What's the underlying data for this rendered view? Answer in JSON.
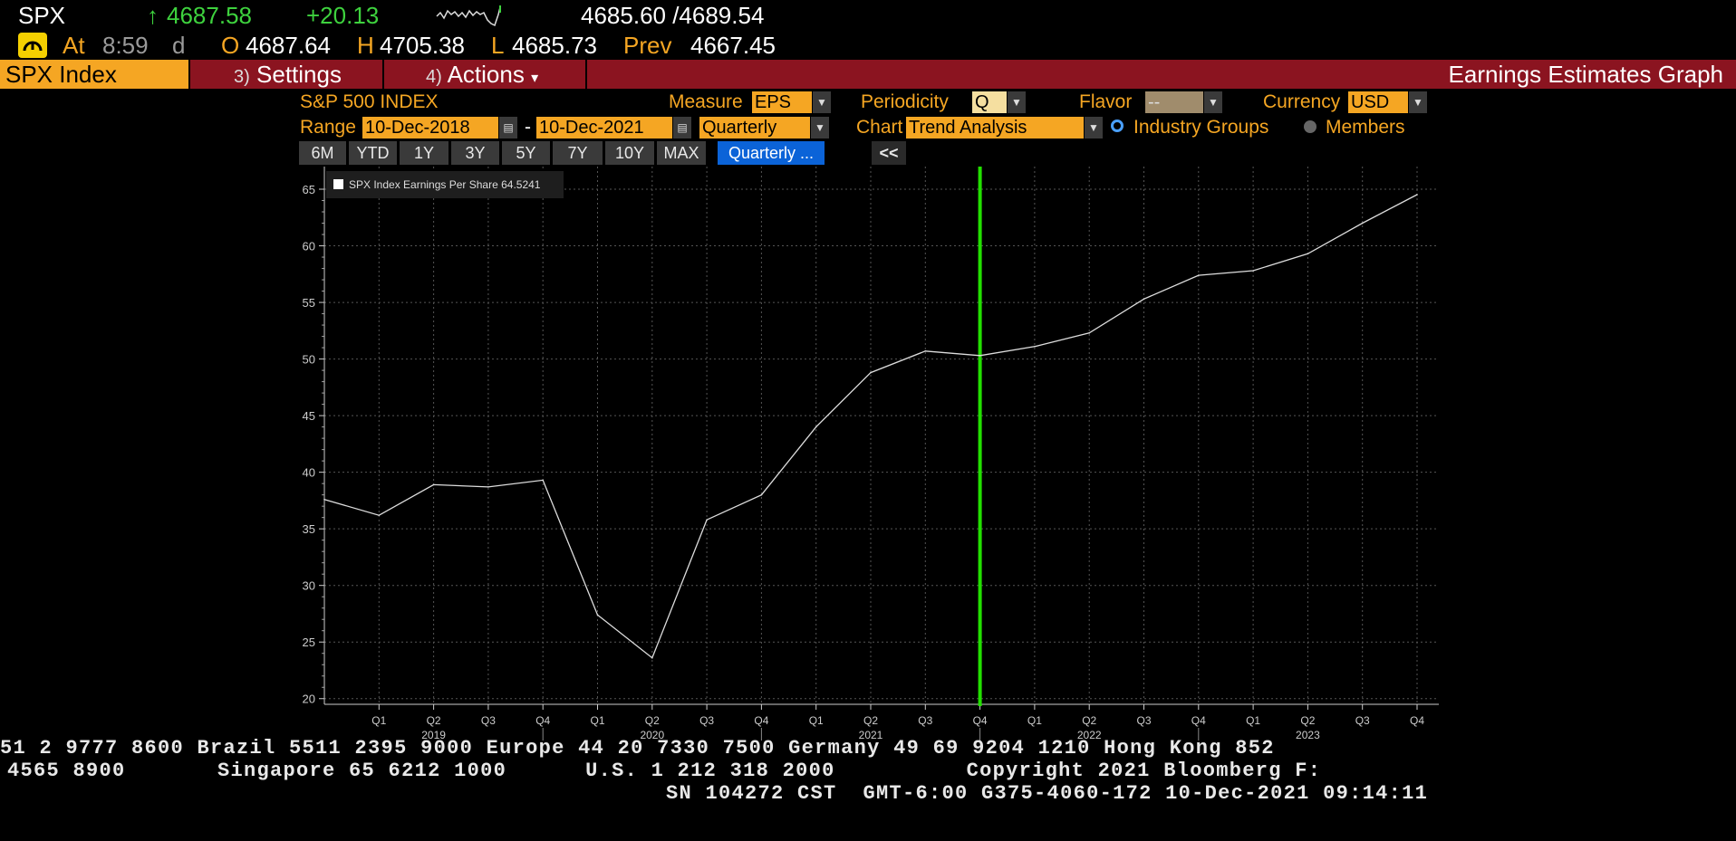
{
  "quote": {
    "ticker": "SPX",
    "arrow": "↑",
    "last": "4687.58",
    "change": "+20.13",
    "bid_ask": "4685.60 /4689.54",
    "at_label": "At",
    "time": "8:59",
    "d": "d",
    "o_label": "O",
    "open": "4687.64",
    "h_label": "H",
    "high": "4705.38",
    "l_label": "L",
    "low": "4685.73",
    "prev_label": "Prev",
    "prev": "4667.45"
  },
  "menu": {
    "security": "SPX Index",
    "settings_num": "3)",
    "settings": "Settings",
    "actions_num": "4)",
    "actions": "Actions",
    "caret": "▾",
    "screen_title": "Earnings Estimates Graph"
  },
  "controls": {
    "index_name": "S&P 500 INDEX",
    "measure_label": "Measure",
    "measure": "EPS",
    "periodicity_label": "Periodicity",
    "periodicity": "Q",
    "flavor_label": "Flavor",
    "flavor": "--",
    "currency_label": "Currency",
    "currency": "USD",
    "range_label": "Range",
    "start_date": "10-Dec-2018",
    "dash": "-",
    "end_date": "10-Dec-2021",
    "range_period": "Quarterly",
    "chart_label": "Chart",
    "chart_type": "Trend Analysis",
    "industry_groups": "Industry Groups",
    "members": "Members",
    "range_buttons": [
      "6M",
      "YTD",
      "1Y",
      "3Y",
      "5Y",
      "7Y",
      "10Y",
      "MAX"
    ],
    "active_button": "Quarterly ...",
    "collapse": "<<"
  },
  "colors": {
    "accent": "#f5a623",
    "bar": "#8b1420",
    "positive": "#3ed23e",
    "marker": "#22e000",
    "series": "#dddddd"
  },
  "chart_data": {
    "type": "line",
    "x": [
      "Q4 2018",
      "Q1 2019",
      "Q2 2019",
      "Q3 2019",
      "Q4 2019",
      "Q1 2020",
      "Q2 2020",
      "Q3 2020",
      "Q4 2020",
      "Q1 2021",
      "Q2 2021",
      "Q3 2021",
      "Q4 2021",
      "Q1 2022",
      "Q2 2022",
      "Q3 2022",
      "Q4 2022",
      "Q1 2023",
      "Q2 2023",
      "Q3 2023",
      "Q4 2023"
    ],
    "tick_labels": [
      "",
      "Q1",
      "Q2",
      "Q3",
      "Q4",
      "Q1",
      "Q2",
      "Q3",
      "Q4",
      "Q1",
      "Q2",
      "Q3",
      "Q4",
      "Q1",
      "Q2",
      "Q3",
      "Q4",
      "Q1",
      "Q2",
      "Q3",
      "Q4"
    ],
    "year_labels": [
      {
        "index": 2,
        "label": "2019"
      },
      {
        "index": 6,
        "label": "2020"
      },
      {
        "index": 10,
        "label": "2021"
      },
      {
        "index": 14,
        "label": "2022"
      },
      {
        "index": 18,
        "label": "2023"
      }
    ],
    "series": [
      {
        "name": "SPX Index Earnings Per Share",
        "values": [
          37.6,
          36.2,
          38.9,
          38.7,
          39.3,
          27.4,
          23.6,
          35.8,
          38.0,
          44.0,
          48.8,
          50.7,
          50.3,
          51.1,
          52.3,
          55.3,
          57.4,
          57.8,
          59.3,
          62.0,
          64.5241
        ]
      }
    ],
    "legend_value": "64.5241",
    "y_ticks": [
      20,
      25,
      30,
      35,
      40,
      45,
      50,
      55,
      60,
      65
    ],
    "ylim": [
      19.5,
      67
    ],
    "current_marker_index": 12,
    "grid": true,
    "legend_position": "top-left"
  },
  "footer": {
    "line1": "51 2 9777 8600 Brazil 5511 2395 9000 Europe 44 20 7330 7500 Germany 49 69 9204 1210 Hong Kong 852",
    "line2": "4565 8900       Singapore 65 6212 1000      U.S. 1 212 318 2000          Copyright 2021 Bloomberg F:",
    "line3": "SN 104272 CST  GMT-6:00 G375-4060-172 10-Dec-2021 09:14:11"
  }
}
